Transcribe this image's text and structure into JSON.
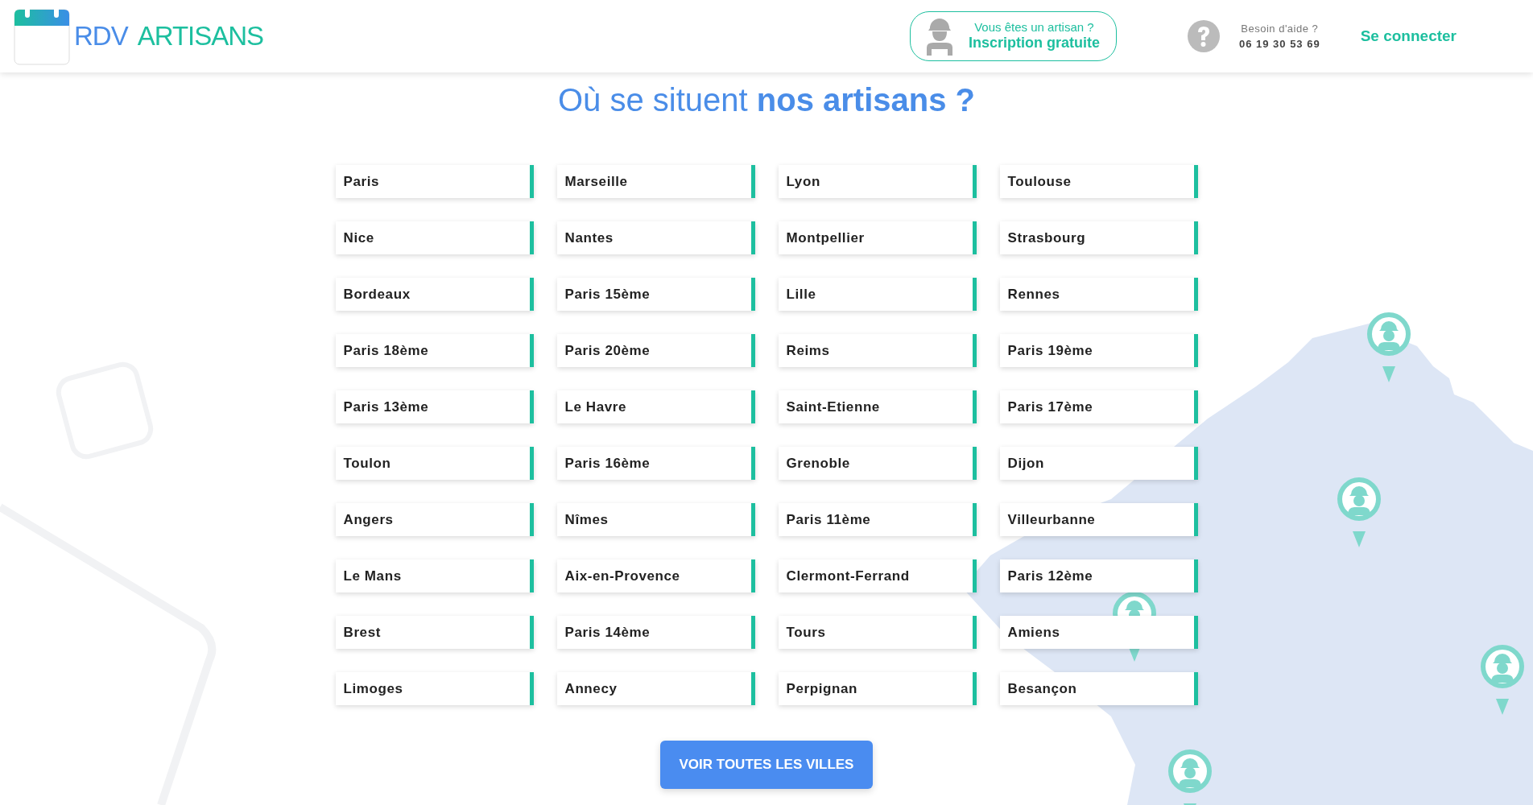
{
  "header": {
    "logo": {
      "part_1": "RDV",
      "part_2": "ARTISANS"
    },
    "signup": {
      "question": "Vous êtes un artisan ?",
      "action": "Inscription gratuite"
    },
    "help": {
      "label": "Besoin d'aide ?",
      "phone": "06 19 30 53 69"
    },
    "login": "Se connecter"
  },
  "title": "Où se situent **nos artisans ?**",
  "cities": [
    "Paris",
    "Marseille",
    "Lyon",
    "Toulouse",
    "Nice",
    "Nantes",
    "Montpellier",
    "Strasbourg",
    "Bordeaux",
    "Paris 15ème",
    "Lille",
    "Rennes",
    "Paris 18ème",
    "Paris 20ème",
    "Reims",
    "Paris 19ème",
    "Paris 13ème",
    "Le Havre",
    "Saint-Etienne",
    "Paris 17ème",
    "Toulon",
    "Paris 16ème",
    "Grenoble",
    "Dijon",
    "Angers",
    "Nîmes",
    "Paris 11ème",
    "Villeurbanne",
    "Le Mans",
    "Aix-en-Provence",
    "Clermont-Ferrand",
    "Paris 12ème",
    "Brest",
    "Paris 14ème",
    "Tours",
    "Amiens",
    "Limoges",
    "Annecy",
    "Perpignan",
    "Besançon"
  ],
  "all_cities_button": "VOIR TOUTES LES VILLES"
}
